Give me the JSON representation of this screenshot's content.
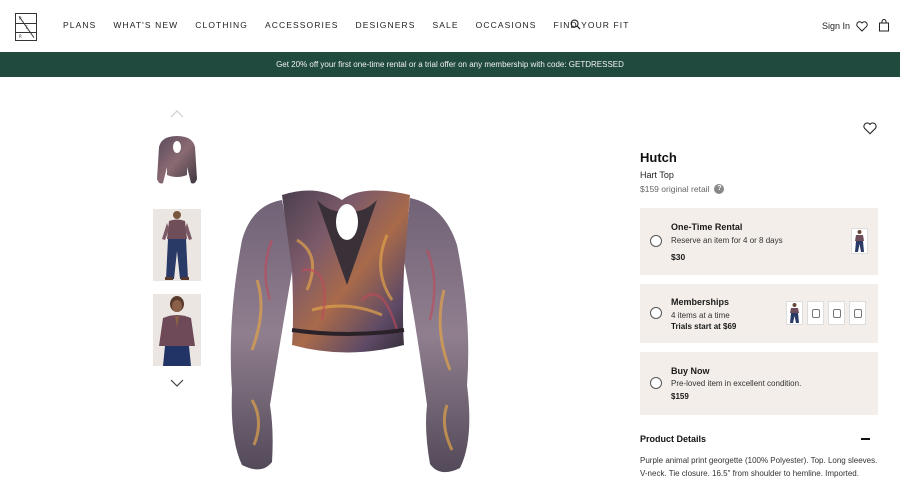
{
  "header": {
    "logo_letters": [
      "R",
      "T",
      "R"
    ],
    "nav": [
      {
        "label": "PLANS"
      },
      {
        "label": "WHAT'S NEW"
      },
      {
        "label": "CLOTHING"
      },
      {
        "label": "ACCESSORIES"
      },
      {
        "label": "DESIGNERS"
      },
      {
        "label": "SALE"
      },
      {
        "label": "OCCASIONS"
      },
      {
        "label": "FIND YOUR FIT"
      }
    ],
    "search_icon": "search-icon",
    "sign_in": "Sign In",
    "heart_icon": "heart-icon",
    "bag_icon": "shopping-bag-icon"
  },
  "promo": {
    "text": "Get 20% off your first one-time rental or a trial offer on any membership with code: GETDRESSED",
    "background": "#1f4a3d"
  },
  "gallery": {
    "up_icon": "chevron-up-icon",
    "down_icon": "chevron-down-icon"
  },
  "product": {
    "brand": "Hutch",
    "name": "Hart Top",
    "retail": "$159 original retail",
    "retail_help": "?",
    "options": [
      {
        "title": "One-Time Rental",
        "desc": "Reserve an item for 4 or 8 days",
        "price": "$30"
      },
      {
        "title": "Memberships",
        "desc": "4 items at a time",
        "price": "Trials start at $69"
      },
      {
        "title": "Buy Now",
        "desc": "Pre-loved item in excellent condition.",
        "price": "$159"
      }
    ],
    "details_title": "Product Details",
    "details_text": "Purple animal print georgette (100% Polyester). Top. Long sleeves. V-neck. Tie closure. 16.5\" from shoulder to hemline. Imported.",
    "option_bg": "#f3eee9"
  }
}
